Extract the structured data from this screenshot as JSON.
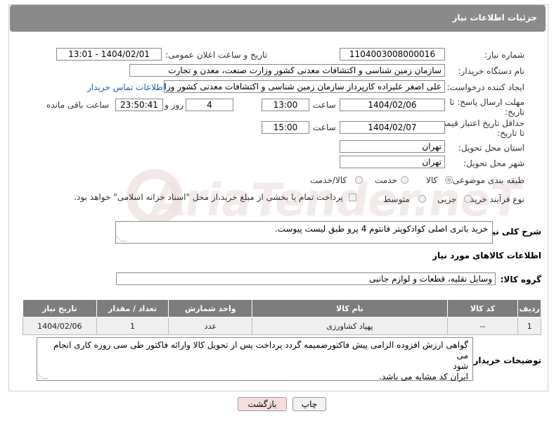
{
  "header": {
    "title": "جزئیات اطلاعات نیاز"
  },
  "fields": {
    "need_number_label": "شماره نیاز:",
    "need_number": "1104003008000016",
    "announce_label": "تاریخ و ساعت اعلان عمومی:",
    "announce_value": "1404/02/01 - 13:01",
    "buyer_org_label": "نام دستگاه خریدار:",
    "buyer_org": "سازمان زمین شناسی و اکتشافات معدنی کشور وزارت صنعت، معدن و تجارت",
    "creator_label": "ایجاد کننده درخواست:",
    "creator": "علی اصغر علیزاده کارپرداز سازمان زمین شناسی و اکتشافات معدنی کشور وزارت",
    "contact_link": "اطلاعات تماس خریدار",
    "deadline_label_1": "مهلت ارسال پاسخ: تا",
    "deadline_label_2": "تاریخ:",
    "deadline_date": "1404/02/06",
    "time_label": "ساعت",
    "deadline_time": "13:00",
    "day_count": "4",
    "day_and": "روز و",
    "remaining_time": "23:50:41",
    "remaining_label": "ساعت باقی مانده",
    "min_price_label_1": "حداقل تاریخ اعتبار قیمت:",
    "min_price_label_2": "تا تاریخ:",
    "min_price_date": "1404/02/07",
    "min_price_time": "15:00",
    "province_label": "استان محل تحویل:",
    "province": "تهران",
    "city_label": "شهر محل تحویل:",
    "city": "تهران",
    "category_label": "طبقه بندی موضوعی:",
    "category_options": [
      "کالا",
      "خدمت",
      "کالا/خدمت"
    ],
    "process_label": "نوع فرآیند خرید :",
    "process_options": [
      "جزیی",
      "متوسط"
    ],
    "payment_note": "پرداخت تمام یا بخشی از مبلغ خرید،از محل \"اسناد خزانه اسلامی\" خواهد بود."
  },
  "description": {
    "label": "شرح کلی نیاز:",
    "text": "خرید باتری اصلی کوادکوپتر فانتوم 4 پرو  طبق لیست پیوست."
  },
  "goods_section": {
    "title": "اطلاعات کالاهای مورد نیاز",
    "group_label": "گروه کالا:",
    "group_value": "وسایل نقلیه، قطعات و لوازم جانبی"
  },
  "table": {
    "headers": [
      "ردیف",
      "کد کالا",
      "نام کالا",
      "واحد شمارش",
      "تعداد / مقدار",
      "تاریخ نیاز"
    ],
    "rows": [
      [
        "1",
        "--",
        "پهپاد کشاورزی",
        "عدد",
        "1",
        "1404/02/06"
      ]
    ]
  },
  "buyer_notes": {
    "label": "توضیحات خریدار:",
    "line1": "گواهی ارزش افزوده الزامی پیش فاکتورضمیمه گردد پرداخت پس از تحویل کالا وارائه فاکتور طی سی روزه کاری انجام می",
    "line2": "شود",
    "line3": "ایران کد مشابه می باشد."
  },
  "buttons": {
    "print": "چاپ",
    "back": "بازگشت"
  },
  "watermark": "AriaTender.neT",
  "colors": {
    "header_bg": "#8a8a8a",
    "table_header_bg": "#7d7d7d",
    "back_button_bg": "#f7dede",
    "link": "#1a5fb4"
  }
}
